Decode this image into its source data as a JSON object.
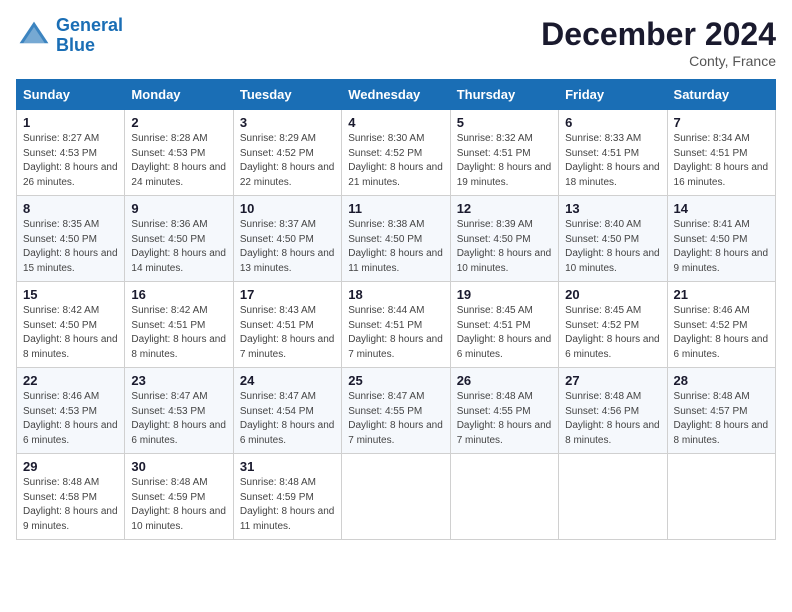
{
  "header": {
    "logo_line1": "General",
    "logo_line2": "Blue",
    "title": "December 2024",
    "location": "Conty, France"
  },
  "weekdays": [
    "Sunday",
    "Monday",
    "Tuesday",
    "Wednesday",
    "Thursday",
    "Friday",
    "Saturday"
  ],
  "weeks": [
    [
      {
        "day": "1",
        "sunrise": "8:27 AM",
        "sunset": "4:53 PM",
        "daylight": "8 hours and 26 minutes."
      },
      {
        "day": "2",
        "sunrise": "8:28 AM",
        "sunset": "4:53 PM",
        "daylight": "8 hours and 24 minutes."
      },
      {
        "day": "3",
        "sunrise": "8:29 AM",
        "sunset": "4:52 PM",
        "daylight": "8 hours and 22 minutes."
      },
      {
        "day": "4",
        "sunrise": "8:30 AM",
        "sunset": "4:52 PM",
        "daylight": "8 hours and 21 minutes."
      },
      {
        "day": "5",
        "sunrise": "8:32 AM",
        "sunset": "4:51 PM",
        "daylight": "8 hours and 19 minutes."
      },
      {
        "day": "6",
        "sunrise": "8:33 AM",
        "sunset": "4:51 PM",
        "daylight": "8 hours and 18 minutes."
      },
      {
        "day": "7",
        "sunrise": "8:34 AM",
        "sunset": "4:51 PM",
        "daylight": "8 hours and 16 minutes."
      }
    ],
    [
      {
        "day": "8",
        "sunrise": "8:35 AM",
        "sunset": "4:50 PM",
        "daylight": "8 hours and 15 minutes."
      },
      {
        "day": "9",
        "sunrise": "8:36 AM",
        "sunset": "4:50 PM",
        "daylight": "8 hours and 14 minutes."
      },
      {
        "day": "10",
        "sunrise": "8:37 AM",
        "sunset": "4:50 PM",
        "daylight": "8 hours and 13 minutes."
      },
      {
        "day": "11",
        "sunrise": "8:38 AM",
        "sunset": "4:50 PM",
        "daylight": "8 hours and 11 minutes."
      },
      {
        "day": "12",
        "sunrise": "8:39 AM",
        "sunset": "4:50 PM",
        "daylight": "8 hours and 10 minutes."
      },
      {
        "day": "13",
        "sunrise": "8:40 AM",
        "sunset": "4:50 PM",
        "daylight": "8 hours and 10 minutes."
      },
      {
        "day": "14",
        "sunrise": "8:41 AM",
        "sunset": "4:50 PM",
        "daylight": "8 hours and 9 minutes."
      }
    ],
    [
      {
        "day": "15",
        "sunrise": "8:42 AM",
        "sunset": "4:50 PM",
        "daylight": "8 hours and 8 minutes."
      },
      {
        "day": "16",
        "sunrise": "8:42 AM",
        "sunset": "4:51 PM",
        "daylight": "8 hours and 8 minutes."
      },
      {
        "day": "17",
        "sunrise": "8:43 AM",
        "sunset": "4:51 PM",
        "daylight": "8 hours and 7 minutes."
      },
      {
        "day": "18",
        "sunrise": "8:44 AM",
        "sunset": "4:51 PM",
        "daylight": "8 hours and 7 minutes."
      },
      {
        "day": "19",
        "sunrise": "8:45 AM",
        "sunset": "4:51 PM",
        "daylight": "8 hours and 6 minutes."
      },
      {
        "day": "20",
        "sunrise": "8:45 AM",
        "sunset": "4:52 PM",
        "daylight": "8 hours and 6 minutes."
      },
      {
        "day": "21",
        "sunrise": "8:46 AM",
        "sunset": "4:52 PM",
        "daylight": "8 hours and 6 minutes."
      }
    ],
    [
      {
        "day": "22",
        "sunrise": "8:46 AM",
        "sunset": "4:53 PM",
        "daylight": "8 hours and 6 minutes."
      },
      {
        "day": "23",
        "sunrise": "8:47 AM",
        "sunset": "4:53 PM",
        "daylight": "8 hours and 6 minutes."
      },
      {
        "day": "24",
        "sunrise": "8:47 AM",
        "sunset": "4:54 PM",
        "daylight": "8 hours and 6 minutes."
      },
      {
        "day": "25",
        "sunrise": "8:47 AM",
        "sunset": "4:55 PM",
        "daylight": "8 hours and 7 minutes."
      },
      {
        "day": "26",
        "sunrise": "8:48 AM",
        "sunset": "4:55 PM",
        "daylight": "8 hours and 7 minutes."
      },
      {
        "day": "27",
        "sunrise": "8:48 AM",
        "sunset": "4:56 PM",
        "daylight": "8 hours and 8 minutes."
      },
      {
        "day": "28",
        "sunrise": "8:48 AM",
        "sunset": "4:57 PM",
        "daylight": "8 hours and 8 minutes."
      }
    ],
    [
      {
        "day": "29",
        "sunrise": "8:48 AM",
        "sunset": "4:58 PM",
        "daylight": "8 hours and 9 minutes."
      },
      {
        "day": "30",
        "sunrise": "8:48 AM",
        "sunset": "4:59 PM",
        "daylight": "8 hours and 10 minutes."
      },
      {
        "day": "31",
        "sunrise": "8:48 AM",
        "sunset": "4:59 PM",
        "daylight": "8 hours and 11 minutes."
      },
      null,
      null,
      null,
      null
    ]
  ]
}
